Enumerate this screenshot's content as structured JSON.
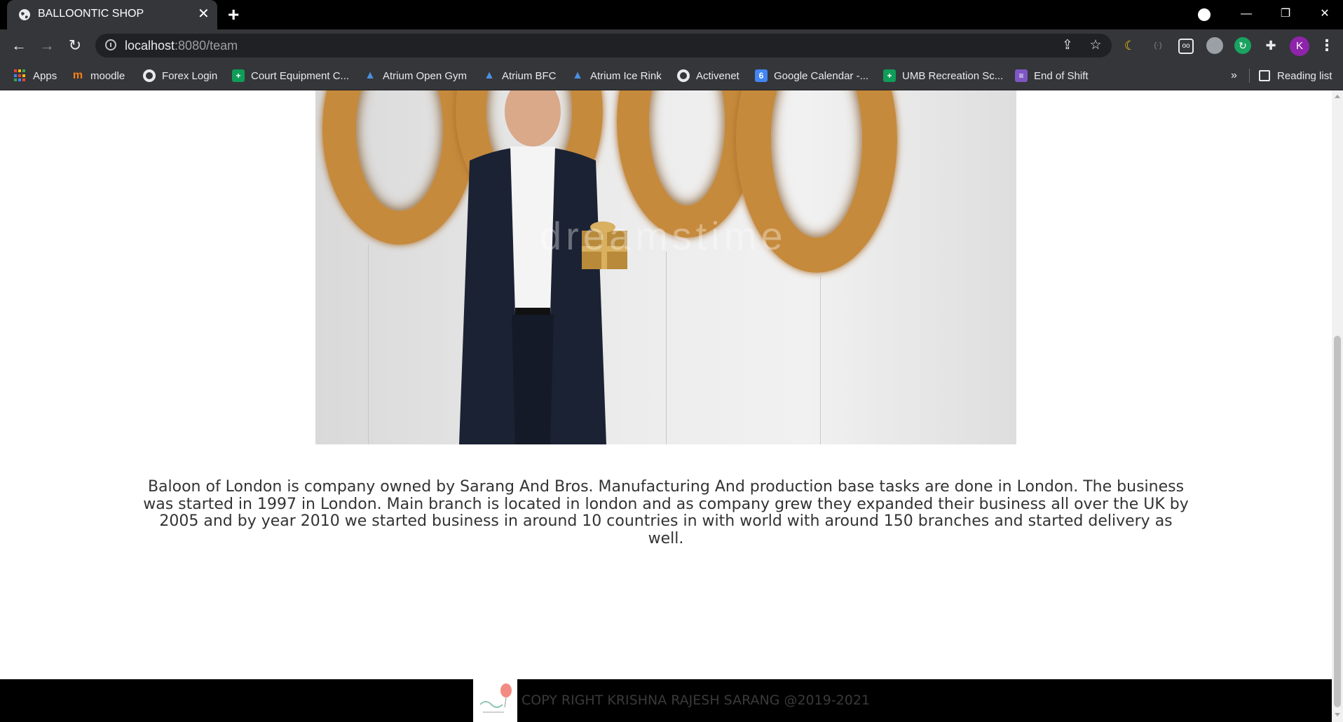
{
  "browser": {
    "tab_title": "BALLOONTIC SHOP",
    "tab_close": "✕",
    "new_tab": "+",
    "url_host": "localhost",
    "url_rest": ":8080/team",
    "window_controls": {
      "minimize": "—",
      "restore": "❐",
      "close": "✕"
    },
    "profile_initial": "K",
    "bookmarks": [
      {
        "label": "Apps",
        "icon": "apps-grid-icon"
      },
      {
        "label": "moodle",
        "icon": "moodle-icon"
      },
      {
        "label": "Forex Login",
        "icon": "globe-icon"
      },
      {
        "label": "Court Equipment C...",
        "icon": "sheets-icon"
      },
      {
        "label": "Atrium Open Gym",
        "icon": "atrium-icon"
      },
      {
        "label": "Atrium BFC",
        "icon": "atrium-icon"
      },
      {
        "label": "Atrium Ice Rink",
        "icon": "atrium-icon"
      },
      {
        "label": "Activenet",
        "icon": "globe-icon"
      },
      {
        "label": "Google Calendar -...",
        "icon": "calendar-icon",
        "badge": "6"
      },
      {
        "label": "UMB Recreation Sc...",
        "icon": "sheets-icon"
      },
      {
        "label": "End of Shift",
        "icon": "list-icon"
      }
    ],
    "more_bookmarks": "»",
    "reading_list": "Reading list"
  },
  "page": {
    "about_text": "Baloon of London is company owned by Sarang And Bros. Manufacturing And production base tasks are done in London. The business was started in 1997 in London. Main branch is located in london and as company grew they expanded their business all over the UK by 2005 and by year 2010 we started business in around 10 countries in with world with around 150 branches and started delivery as well.",
    "footer_text": "COPY RIGHT KRISHNA RAJESH SARANG @2019-2021",
    "hero_watermark": "dreamstime"
  },
  "colors": {
    "chrome_dark": "#35363a",
    "tabbar": "#000000",
    "footer": "#000000",
    "balloon_gold": "#c68a3d",
    "body_text": "#333333"
  }
}
